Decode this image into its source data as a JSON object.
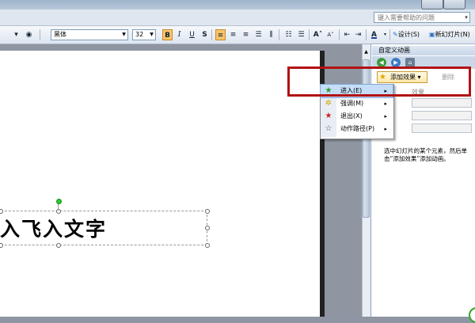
{
  "help": {
    "placeholder": "键入需要帮助的问题",
    "arrow": "▾"
  },
  "toolbar": {
    "font_name": "黑体",
    "font_size": "32",
    "bold": "B",
    "italic": "I",
    "underline": "U",
    "shadow": "S",
    "font_color_glyph": "A",
    "design_label": "设计(S)",
    "new_slide_label": "新幻灯片(N)"
  },
  "slide": {
    "text": "入飞入文字"
  },
  "task_pane": {
    "title": "自定义动画",
    "add_effect_label": "添加效果",
    "add_effect_arrow": "▾",
    "delete_label": "删除",
    "effect_label": "效果",
    "hint": "选中幻灯片的某个元素，然后单击“添加效果”添加动画。"
  },
  "menu": {
    "items": [
      {
        "label": "进入(E)",
        "icon": "entrance-star-icon",
        "glyph": "★",
        "color": "#2a9a2a"
      },
      {
        "label": "强调(M)",
        "icon": "emphasis-star-icon",
        "glyph": "✲",
        "color": "#d4a600"
      },
      {
        "label": "退出(X)",
        "icon": "exit-star-icon",
        "glyph": "★",
        "color": "#cc2222"
      },
      {
        "label": "动作路径(P)",
        "icon": "motion-path-star-icon",
        "glyph": "☆",
        "color": "#335577"
      }
    ],
    "submenu_arrow": "▸"
  },
  "colors": {
    "highlight": "#c5ddf7",
    "annotation_red": "#b11212"
  }
}
